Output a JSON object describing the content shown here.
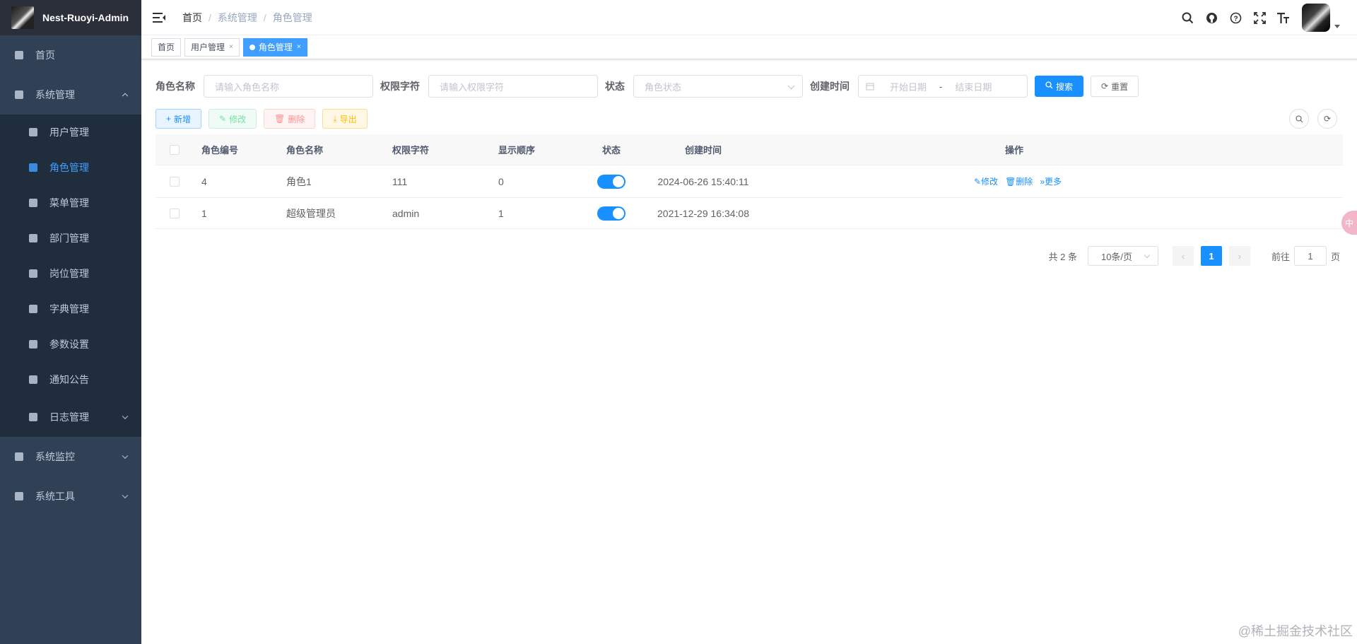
{
  "app": {
    "title": "Nest-Ruoyi-Admin"
  },
  "sidebar": {
    "items": [
      {
        "label": "首页"
      },
      {
        "label": "系统管理"
      },
      {
        "label": "系统监控"
      },
      {
        "label": "系统工具"
      }
    ],
    "system_children": [
      {
        "label": "用户管理"
      },
      {
        "label": "角色管理"
      },
      {
        "label": "菜单管理"
      },
      {
        "label": "部门管理"
      },
      {
        "label": "岗位管理"
      },
      {
        "label": "字典管理"
      },
      {
        "label": "参数设置"
      },
      {
        "label": "通知公告"
      },
      {
        "label": "日志管理"
      }
    ]
  },
  "breadcrumb": [
    "首页",
    "系统管理",
    "角色管理"
  ],
  "tags": [
    {
      "label": "首页"
    },
    {
      "label": "用户管理",
      "close": "×"
    },
    {
      "label": "角色管理",
      "close": "×"
    }
  ],
  "search": {
    "role_name_label": "角色名称",
    "role_name_placeholder": "请输入角色名称",
    "role_key_label": "权限字符",
    "role_key_placeholder": "请输入权限字符",
    "status_label": "状态",
    "status_placeholder": "角色状态",
    "created_label": "创建时间",
    "start_placeholder": "开始日期",
    "range_sep": "-",
    "end_placeholder": "结束日期",
    "search_btn": "搜索",
    "reset_btn": "重置"
  },
  "toolbar": {
    "add": "新增",
    "edit": "修改",
    "delete": "删除",
    "export": "导出"
  },
  "table": {
    "headers": [
      "角色编号",
      "角色名称",
      "权限字符",
      "显示顺序",
      "状态",
      "创建时间",
      "操作"
    ],
    "rows": [
      {
        "id": "4",
        "name": "角色1",
        "key": "111",
        "sort": "0",
        "status": "on",
        "created": "2024-06-26 15:40:11",
        "ops": [
          "修改",
          "删除",
          "更多"
        ]
      },
      {
        "id": "1",
        "name": "超级管理员",
        "key": "admin",
        "sort": "1",
        "status": "on",
        "created": "2021-12-29 16:34:08",
        "ops": []
      }
    ]
  },
  "pagination": {
    "total": "共 2 条",
    "page_size": "10条/页",
    "current": "1",
    "goto_prefix": "前往",
    "goto_value": "1",
    "goto_suffix": "页"
  },
  "float_button": "中",
  "watermark": "@稀土掘金技术社区",
  "colors": {
    "sidebar_bg": "#304156",
    "submenu_bg": "#1f2d3d",
    "primary": "#1890ff"
  }
}
